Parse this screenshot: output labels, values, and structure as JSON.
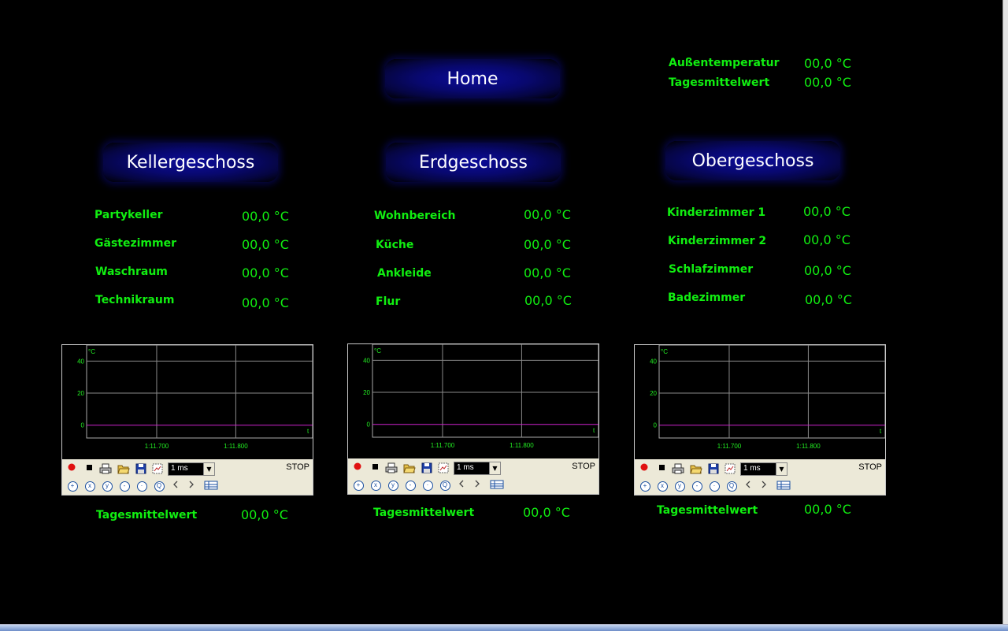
{
  "nav": {
    "home": "Home",
    "keller": "Kellergeschoss",
    "erd": "Erdgeschoss",
    "ober": "Obergeschoss"
  },
  "outdoor": {
    "temp_label": "Außentemperatur",
    "temp_value": "00,0 °C",
    "avg_label": "Tagesmittelwert",
    "avg_value": "00,0 °C"
  },
  "floors": [
    {
      "rooms": [
        {
          "name": "Partykeller",
          "value": "00,0 °C"
        },
        {
          "name": "Gästezimmer",
          "value": "00,0 °C"
        },
        {
          "name": "Waschraum",
          "value": "00,0 °C"
        },
        {
          "name": "Technikraum",
          "value": "00,0 °C"
        }
      ],
      "avg_label": "Tagesmittelwert",
      "avg_value": "00,0 °C"
    },
    {
      "rooms": [
        {
          "name": "Wohnbereich",
          "value": "00,0 °C"
        },
        {
          "name": "Küche",
          "value": "00,0 °C"
        },
        {
          "name": "Ankleide",
          "value": "00,0 °C"
        },
        {
          "name": "Flur",
          "value": "00,0 °C"
        }
      ],
      "avg_label": "Tagesmittelwert",
      "avg_value": "00,0 °C"
    },
    {
      "rooms": [
        {
          "name": "Kinderzimmer 1",
          "value": "00,0 °C"
        },
        {
          "name": "Kinderzimmer 2",
          "value": "00,0 °C"
        },
        {
          "name": "Schlafzimmer",
          "value": "00,0 °C"
        },
        {
          "name": "Badezimmer",
          "value": "00,0 °C"
        }
      ],
      "avg_label": "Tagesmittelwert",
      "avg_value": "00,0 °C"
    }
  ],
  "chart_data": [
    {
      "type": "line",
      "ylabel": "°C",
      "xlabel": "t",
      "yticks": [
        "0",
        "20",
        "40"
      ],
      "ylim": [
        -8,
        50
      ],
      "xticks": [
        "1:11.700",
        "1:11.800"
      ],
      "series": [
        {
          "values": [
            0,
            0
          ]
        }
      ],
      "line_color": "#cc22cc",
      "grid": true
    },
    {
      "type": "line",
      "ylabel": "°C",
      "xlabel": "t",
      "yticks": [
        "0",
        "20",
        "40"
      ],
      "ylim": [
        -8,
        50
      ],
      "xticks": [
        "1:11.700",
        "1:11.800"
      ],
      "series": [
        {
          "values": [
            0,
            0
          ]
        }
      ],
      "line_color": "#cc22cc",
      "grid": true
    },
    {
      "type": "line",
      "ylabel": "°C",
      "xlabel": "t",
      "yticks": [
        "0",
        "20",
        "40"
      ],
      "ylim": [
        -8,
        50
      ],
      "xticks": [
        "1:11.700",
        "1:11.800"
      ],
      "series": [
        {
          "values": [
            0,
            0
          ]
        }
      ],
      "line_color": "#cc22cc",
      "grid": true
    }
  ],
  "recorder": {
    "interval": "1 ms",
    "state": "STOP"
  },
  "icons": [
    "record-icon",
    "stop-icon",
    "print-icon",
    "open-folder-icon",
    "save-icon",
    "export-icon",
    "zoom-in-icon",
    "zoom-x-icon",
    "zoom-y-icon",
    "zoom-out-icon",
    "zoom-reset-icon",
    "zoom-fit-icon",
    "scroll-left-icon",
    "scroll-right-icon",
    "table-icon"
  ]
}
